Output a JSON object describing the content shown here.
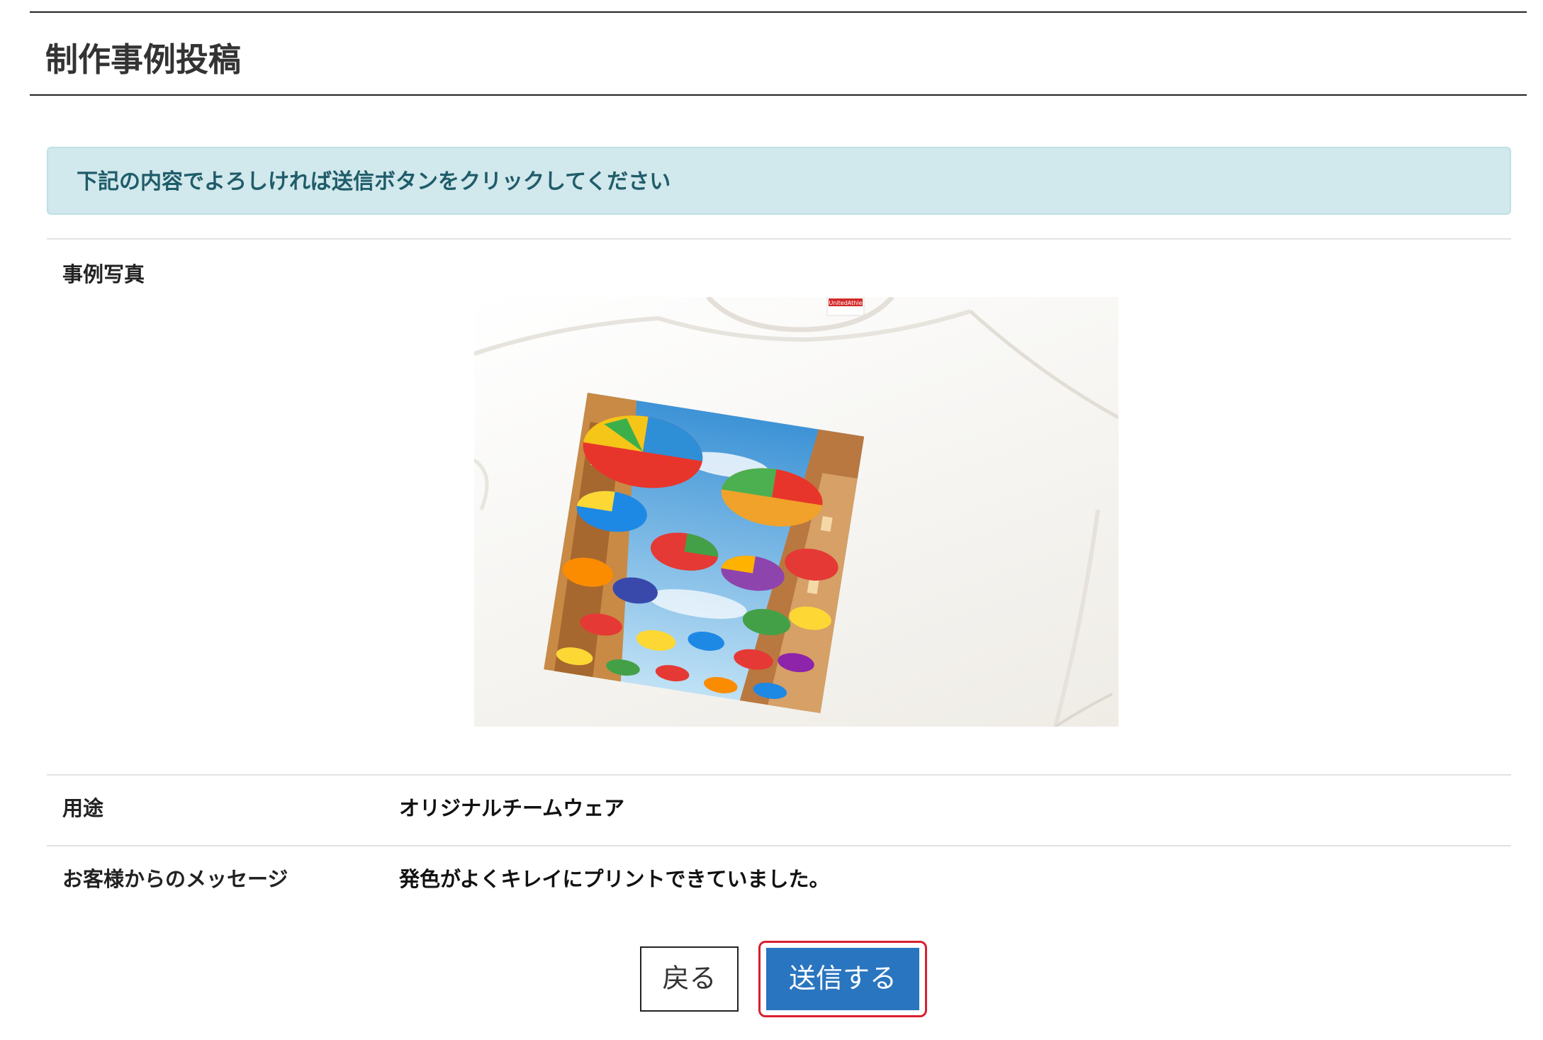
{
  "page": {
    "title": "制作事例投稿"
  },
  "alert": {
    "message": "下記の内容でよろしければ送信ボタンをクリックしてください",
    "color": "#1f5c6a",
    "background": "#d1e8ec"
  },
  "form": {
    "photo": {
      "label": "事例写真",
      "tag_text": "UnitedAthle"
    },
    "usage": {
      "label": "用途",
      "value": "オリジナルチームウェア"
    },
    "message": {
      "label": "お客様からのメッセージ",
      "value": "発色がよくキレイにプリントできていました。"
    }
  },
  "buttons": {
    "back_label": "戻る",
    "submit_label": "送信する"
  },
  "colors": {
    "submit": "#2a75c0",
    "focus_ring": "#d8202f"
  }
}
